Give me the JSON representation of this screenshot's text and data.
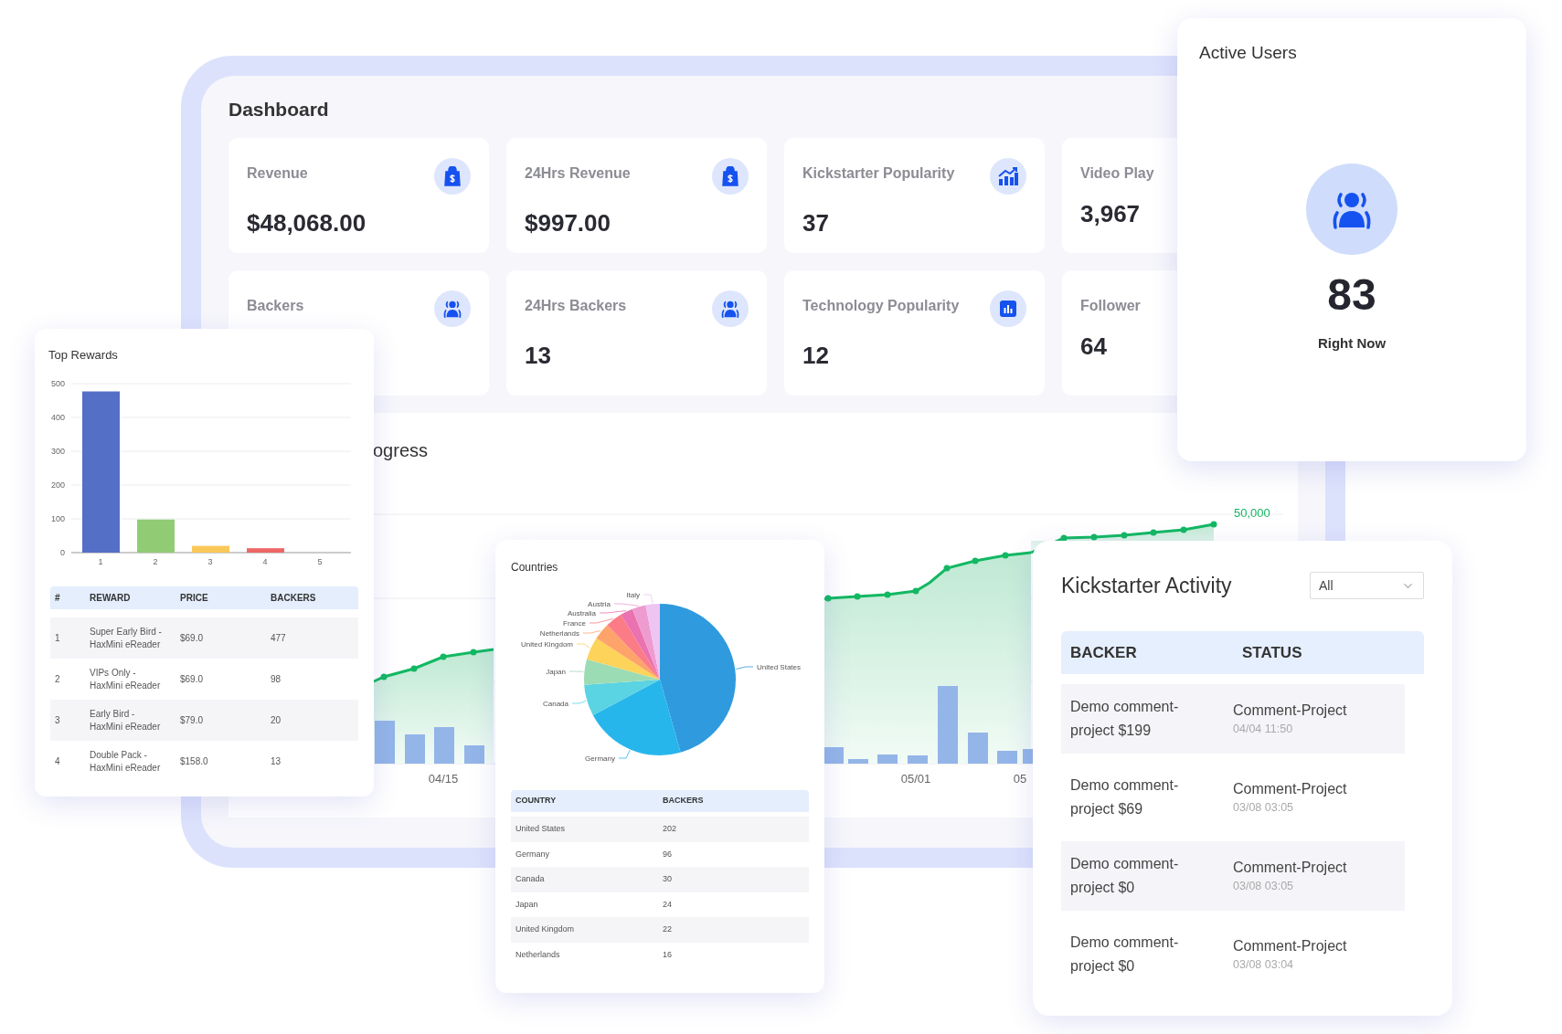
{
  "dashboard": {
    "title": "Dashboard",
    "stats": [
      {
        "label": "Revenue",
        "value": "$48,068.00"
      },
      {
        "label": "24Hrs Revenue",
        "value": "$997.00"
      },
      {
        "label": "Kickstarter Popularity",
        "value": "37"
      },
      {
        "label": "Video Play",
        "value": "3,967"
      },
      {
        "label": "Backers"
      },
      {
        "label": "24Hrs Backers",
        "value": "13"
      },
      {
        "label": "Technology Popularity",
        "value": "12"
      },
      {
        "label": "Follower",
        "value": "64"
      }
    ],
    "progress": {
      "title": "ogress",
      "x_labels": [
        "04/15",
        "05/01",
        "05"
      ],
      "goal_label": "50,000"
    }
  },
  "top_rewards": {
    "title": "Top Rewards",
    "chart_data": {
      "type": "bar",
      "categories": [
        "1",
        "2",
        "3",
        "4",
        "5"
      ],
      "series": [
        {
          "values": [
            477,
            98,
            20,
            13,
            0
          ]
        }
      ],
      "ylim": [
        0,
        500
      ],
      "yticks": [
        0,
        100,
        200,
        300,
        400,
        500
      ],
      "grid": true
    },
    "table": {
      "columns": [
        "#",
        "REWARD",
        "PRICE",
        "BACKERS"
      ],
      "rows": [
        [
          "1",
          "Super Early Bird - HaxMini eReader",
          "$69.0",
          "477"
        ],
        [
          "2",
          "VIPs Only - HaxMini eReader",
          "$69.0",
          "98"
        ],
        [
          "3",
          "Early Bird - HaxMini eReader",
          "$79.0",
          "20"
        ],
        [
          "4",
          "Double Pack - HaxMini eReader",
          "$158.0",
          "13"
        ]
      ]
    }
  },
  "countries": {
    "title": "Countries",
    "chart_data": {
      "type": "pie",
      "categories": [
        "United States",
        "Germany",
        "Canada",
        "Japan",
        "United Kingdom",
        "Netherlands",
        "France",
        "Australia",
        "Austria",
        "Italy"
      ],
      "values": [
        45.6,
        21.6,
        6.7,
        5.4,
        4.9,
        3.6,
        3.6,
        2.7,
        2.9,
        3.0
      ]
    },
    "table": {
      "columns": [
        "COUNTRY",
        "BACKERS"
      ],
      "rows": [
        [
          "United States",
          "202"
        ],
        [
          "Germany",
          "96"
        ],
        [
          "Canada",
          "30"
        ],
        [
          "Japan",
          "24"
        ],
        [
          "United Kingdom",
          "22"
        ],
        [
          "Netherlands",
          "16"
        ]
      ]
    }
  },
  "kickstarter_activity": {
    "title": "Kickstarter Activity",
    "filter": {
      "value": "All"
    },
    "table": {
      "columns": [
        "BACKER",
        "STATUS"
      ],
      "rows": [
        {
          "backer": "Demo comment-project $199",
          "status": "Comment-Project",
          "time": "04/04 11:50"
        },
        {
          "backer": "Demo comment-project $69",
          "status": "Comment-Project",
          "time": "03/08 03:05"
        },
        {
          "backer": "Demo comment-project $0",
          "status": "Comment-Project",
          "time": "03/08 03:05"
        },
        {
          "backer": "Demo comment-project $0",
          "status": "Comment-Project",
          "time": "03/08 03:04"
        }
      ]
    }
  },
  "active_users": {
    "title": "Active Users",
    "count": "83",
    "caption": "Right Now"
  }
}
